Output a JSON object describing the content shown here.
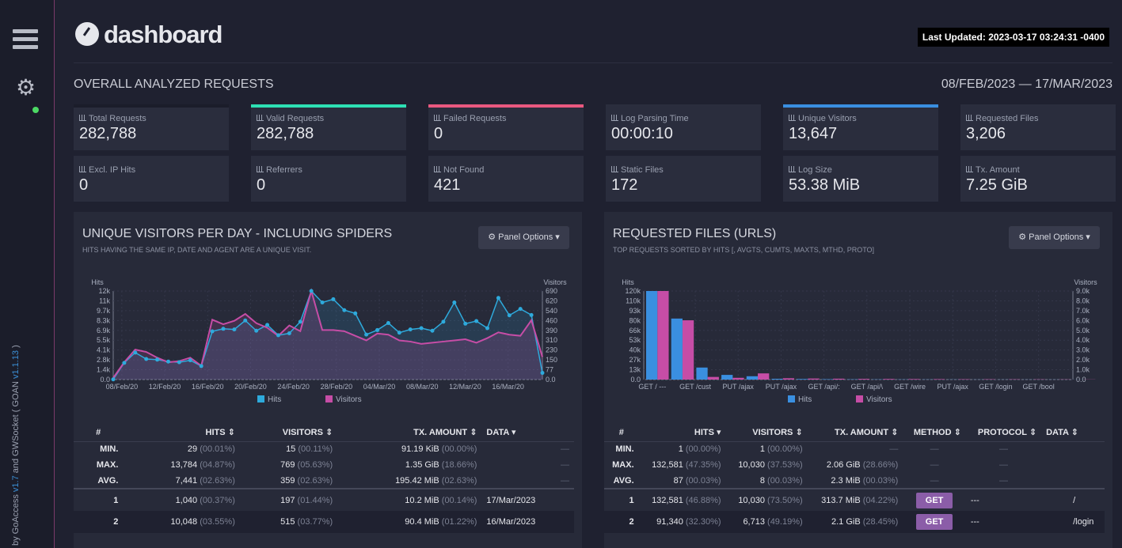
{
  "app": {
    "brand": "dashboard",
    "last_updated": "Last Updated: 2023-03-17 03:24:31 -0400"
  },
  "sidebar": {
    "credit_pre": "by ",
    "goaccess": "GoAccess",
    "goaccess_v": "v1.7",
    "and": " and ",
    "gwsocket": "GWSocket",
    "goan": "( GOAN ",
    "goan_v": "v1.1.13",
    "goan_end": " )"
  },
  "overall": {
    "title": "OVERALL ANALYZED REQUESTS",
    "date_range": "08/FEB/2023 — 17/MAR/2023"
  },
  "cards": [
    {
      "label": "Total Requests",
      "value": "282,788",
      "accent": "#1b1d2a"
    },
    {
      "label": "Valid Requests",
      "value": "282,788",
      "accent": "#2de0b4"
    },
    {
      "label": "Failed Requests",
      "value": "0",
      "accent": "#e9587f"
    },
    {
      "label": "Log Parsing Time",
      "value": "00:00:10",
      "accent": "#2a2d3d"
    },
    {
      "label": "Unique Visitors",
      "value": "13,647",
      "accent": "#3a8fe0"
    },
    {
      "label": "Requested Files",
      "value": "3,206",
      "accent": "#2a2d3d"
    },
    {
      "label": "Excl. IP Hits",
      "value": "0"
    },
    {
      "label": "Referrers",
      "value": "0"
    },
    {
      "label": "Not Found",
      "value": "421"
    },
    {
      "label": "Static Files",
      "value": "172"
    },
    {
      "label": "Log Size",
      "value": "53.38 MiB"
    },
    {
      "label": "Tx. Amount",
      "value": "7.25 GiB"
    }
  ],
  "visitors_panel": {
    "title": "UNIQUE VISITORS PER DAY - INCLUDING SPIDERS",
    "subtitle": "HITS HAVING THE SAME IP, DATE AND AGENT ARE A UNIQUE VISIT.",
    "options": "Panel Options",
    "table": {
      "headers": [
        "#",
        "HITS ⇕",
        "VISITORS ⇕",
        "TX. AMOUNT ⇕",
        "DATA ▾"
      ],
      "min": {
        "label": "MIN.",
        "hits": "29",
        "hits_p": "(00.01%)",
        "vis": "15",
        "vis_p": "(00.11%)",
        "tx": "91.19 KiB",
        "tx_p": "(00.00%)",
        "data": "—"
      },
      "max": {
        "label": "MAX.",
        "hits": "13,784",
        "hits_p": "(04.87%)",
        "vis": "769",
        "vis_p": "(05.63%)",
        "tx": "1.35 GiB",
        "tx_p": "(18.66%)",
        "data": "—"
      },
      "avg": {
        "label": "AVG.",
        "hits": "7,441",
        "hits_p": "(02.63%)",
        "vis": "359",
        "vis_p": "(02.63%)",
        "tx": "195.42 MiB",
        "tx_p": "(02.63%)",
        "data": "—"
      },
      "rows": [
        {
          "n": "1",
          "hits": "1,040",
          "hits_p": "(00.37%)",
          "vis": "197",
          "vis_p": "(01.44%)",
          "tx": "10.2 MiB",
          "tx_p": "(00.14%)",
          "data": "17/Mar/2023"
        },
        {
          "n": "2",
          "hits": "10,048",
          "hits_p": "(03.55%)",
          "vis": "515",
          "vis_p": "(03.77%)",
          "tx": "90.4 MiB",
          "tx_p": "(01.22%)",
          "data": "16/Mar/2023"
        }
      ]
    }
  },
  "files_panel": {
    "title": "REQUESTED FILES (URLS)",
    "subtitle": "TOP REQUESTS SORTED BY HITS [, AVGTS, CUMTS, MAXTS, MTHD, PROTO]",
    "options": "Panel Options",
    "table": {
      "headers": [
        "#",
        "HITS ▾",
        "VISITORS ⇕",
        "TX. AMOUNT ⇕",
        "METHOD ⇕",
        "PROTOCOL ⇕",
        "DATA ⇕"
      ],
      "min": {
        "label": "MIN.",
        "hits": "1",
        "hits_p": "(00.00%)",
        "vis": "1",
        "vis_p": "(00.00%)",
        "tx": "—",
        "method": "—",
        "proto": "—"
      },
      "max": {
        "label": "MAX.",
        "hits": "132,581",
        "hits_p": "(47.35%)",
        "vis": "10,030",
        "vis_p": "(37.53%)",
        "tx": "2.06 GiB",
        "tx_p": "(28.66%)",
        "method": "—",
        "proto": "—"
      },
      "avg": {
        "label": "AVG.",
        "hits": "87",
        "hits_p": "(00.03%)",
        "vis": "8",
        "vis_p": "(00.03%)",
        "tx": "2.3 MiB",
        "tx_p": "(00.03%)",
        "method": "—",
        "proto": "—"
      },
      "rows": [
        {
          "n": "1",
          "hits": "132,581",
          "hits_p": "(46.88%)",
          "vis": "10,030",
          "vis_p": "(73.50%)",
          "tx": "313.7 MiB",
          "tx_p": "(04.22%)",
          "method": "GET",
          "proto": "---",
          "data": "/"
        },
        {
          "n": "2",
          "hits": "91,340",
          "hits_p": "(32.30%)",
          "vis": "6,713",
          "vis_p": "(49.19%)",
          "tx": "2.1 GiB",
          "tx_p": "(28.45%)",
          "method": "GET",
          "proto": "---",
          "data": "/login"
        }
      ]
    }
  },
  "chart_data": [
    {
      "type": "area",
      "ylabel": "Hits",
      "y2label": "Visitors",
      "y_ticks": [
        "12k",
        "11k",
        "9.7k",
        "8.3k",
        "6.9k",
        "5.5k",
        "4.1k",
        "2.8k",
        "1.4k",
        "0.0"
      ],
      "y2_ticks": [
        "690",
        "620",
        "540",
        "460",
        "390",
        "310",
        "230",
        "150",
        "77",
        "0.0"
      ],
      "x_ticks": [
        "08/Feb/20",
        "12/Feb/20",
        "16/Feb/20",
        "20/Feb/20",
        "24/Feb/20",
        "28/Feb/20",
        "04/Mar/20",
        "08/Mar/20",
        "12/Mar/20",
        "16/Mar/20"
      ],
      "series": [
        {
          "name": "Hits",
          "color": "#2eaadc",
          "values": [
            29,
            2600,
            4200,
            3200,
            3100,
            2800,
            2700,
            3000,
            2100,
            7500,
            7900,
            7800,
            9200,
            7600,
            8500,
            6900,
            7200,
            9000,
            13784,
            12000,
            12500,
            10800,
            10300,
            7000,
            7700,
            8800,
            7300,
            7800,
            8000,
            7600,
            9000,
            12000,
            8700,
            9100,
            8000,
            12700,
            10000,
            11000,
            10048,
            1040
          ]
        },
        {
          "name": "Visitors",
          "color": "#c64da6",
          "values": [
            15,
            150,
            260,
            240,
            190,
            150,
            160,
            190,
            120,
            520,
            480,
            510,
            570,
            490,
            450,
            380,
            470,
            420,
            769,
            430,
            430,
            420,
            380,
            340,
            400,
            390,
            340,
            330,
            310,
            320,
            330,
            340,
            350,
            320,
            360,
            410,
            390,
            380,
            515,
            197
          ]
        }
      ],
      "legend": [
        "Hits",
        "Visitors"
      ]
    },
    {
      "type": "bar",
      "ylabel": "Hits",
      "y2label": "Visitors",
      "y_ticks": [
        "120k",
        "110k",
        "93k",
        "80k",
        "66k",
        "53k",
        "40k",
        "27k",
        "13k",
        "0.0"
      ],
      "y2_ticks": [
        "9.0k",
        "8.0k",
        "7.0k",
        "6.0k",
        "5.0k",
        "4.0k",
        "3.0k",
        "2.0k",
        "1.0k",
        "0.0"
      ],
      "x_ticks": [
        "GET / ---",
        "GET /cust",
        "PUT /ajax",
        "PUT /ajax",
        "GET /api/:",
        "GET /api/\\",
        "GET /wire",
        "PUT /ajax",
        "GET /login",
        "GET /bool"
      ],
      "series": [
        {
          "name": "Hits",
          "color": "#3a8fe0",
          "values": [
            132581,
            91340,
            18000,
            7000,
            5000,
            1200,
            900,
            600,
            400,
            300,
            250,
            200,
            150,
            120,
            100,
            90,
            80,
            70
          ]
        },
        {
          "name": "Visitors",
          "color": "#c64da6",
          "values": [
            10030,
            6713,
            300,
            200,
            700,
            150,
            120,
            100,
            80,
            70,
            60,
            50,
            40,
            35,
            30,
            25,
            20,
            15
          ]
        }
      ],
      "legend": [
        "Hits",
        "Visitors"
      ]
    }
  ]
}
